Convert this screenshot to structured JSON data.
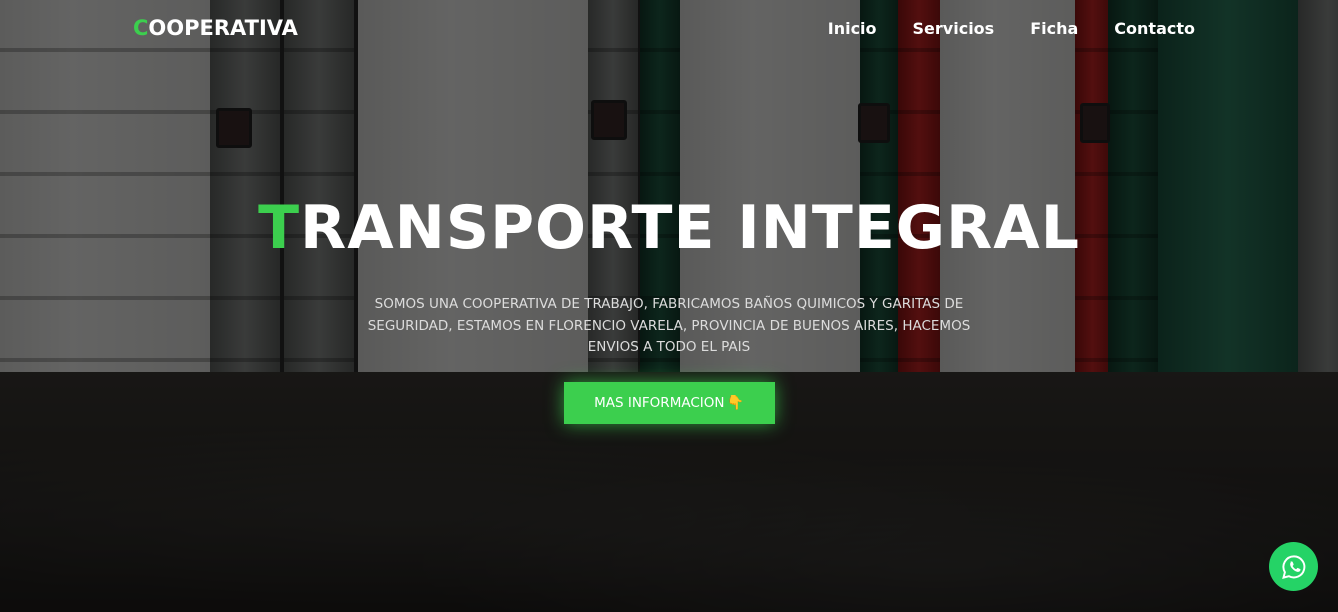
{
  "nav": {
    "logo_first": "C",
    "logo_rest": "OOPERATIVA",
    "links": [
      {
        "label": "Inicio"
      },
      {
        "label": "Servicios"
      },
      {
        "label": "Ficha"
      },
      {
        "label": "Contacto"
      }
    ]
  },
  "hero": {
    "title_first": "T",
    "title_rest": "RANSPORTE INTEGRAL",
    "description": "SOMOS UNA COOPERATIVA DE TRABAJO, FABRICAMOS BAÑOS QUIMICOS Y GARITAS DE SEGURIDAD, ESTAMOS EN FLORENCIO VARELA, PROVINCIA DE BUENOS AIRES, HACEMOS ENVIOS A TODO EL PAIS",
    "cta_label": "MAS INFORMACION",
    "cta_icon": "👇"
  },
  "icons": {
    "cta": "pointing-hand-icon",
    "float": "whatsapp-icon"
  },
  "colors": {
    "accent": "#3ccf4e",
    "whatsapp": "#25d366",
    "text": "#ffffff"
  }
}
